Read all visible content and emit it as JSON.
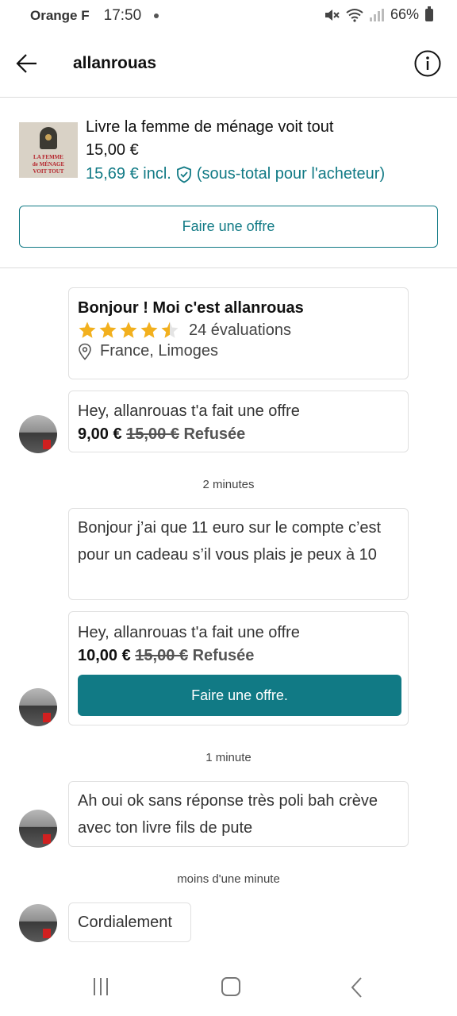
{
  "status_bar": {
    "carrier": "Orange F",
    "time": "17:50",
    "battery": "66%"
  },
  "header": {
    "username": "allanrouas"
  },
  "item": {
    "title": "Livre la femme de ménage voit tout",
    "price": "15,00 €",
    "price_incl": "15,69 € incl.",
    "subtotal_note": "(sous-total pour l'acheteur)",
    "cover_text": [
      "LA FEMME",
      "de MÉNAGE",
      "VOIT TOUT"
    ],
    "offer_button": "Faire une offre"
  },
  "profile_card": {
    "title": "Bonjour ! Moi c'est allanrouas",
    "rating": 4.5,
    "rating_count": "24 évaluations",
    "location": "France, Limoges"
  },
  "messages": [
    {
      "type": "offer",
      "text": "Hey, allanrouas t'a fait une offre",
      "offer_price": "9,00 €",
      "original_price": "15,00 €",
      "status": "Refusée"
    },
    {
      "type": "timestamp",
      "text": "2 minutes"
    },
    {
      "type": "text",
      "text": "Bonjour j’ai que 11 euro sur le compte c’est pour un cadeau s’il vous plais je peux à 10"
    },
    {
      "type": "offer",
      "text": "Hey, allanrouas t'a fait une offre",
      "offer_price": "10,00 €",
      "original_price": "15,00 €",
      "status": "Refusée",
      "button": "Faire une offre."
    },
    {
      "type": "timestamp",
      "text": "1 minute"
    },
    {
      "type": "text",
      "text": "Ah oui ok sans réponse très poli bah crève avec ton livre fils de pute"
    },
    {
      "type": "timestamp",
      "text": "moins d'une minute"
    },
    {
      "type": "text",
      "text": "Cordialement"
    }
  ],
  "colors": {
    "accent": "#117a85",
    "star": "#f2b01e"
  }
}
